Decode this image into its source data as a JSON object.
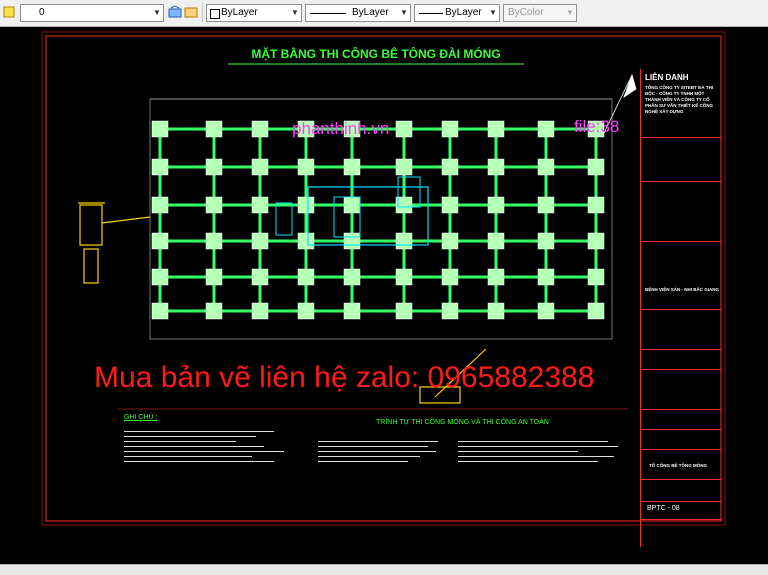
{
  "toolbar": {
    "layer_value": "0",
    "color_value": "ByLayer",
    "linetype_value": "ByLayer",
    "lineweight_value": "ByLayer",
    "plotstyle_value": "ByColor"
  },
  "drawing": {
    "title": "MẶT BẰNG THI CÔNG BÊ TÔNG ĐÀI MÓNG",
    "notes_heading": "GHI CHÚ :",
    "sequence_heading": "TRÌNH TỰ THI CÔNG MÓNG VÀ THI CÔNG AN TOÀN",
    "sheet_code": "BPTC - 08",
    "title_block": {
      "company": "LIÊN DANH",
      "company_detail": "TỔNG CÔNG TY SITEBT ĐÀ THI BỘC - CÔNG TY TNHH MỘT THÀNH VIÊN VÀ CÔNG TY CỔ PHẦN SƯ VẤN THIẾT KẾ CÔNG NGHỆ XÂY DỰNG",
      "project": "BỆNH VIỆN SẢN - NHI BẮC GIANG",
      "sheet_name": "TỔ CÔNG BÊ TÔNG MÓNG"
    }
  },
  "overlays": {
    "site": "phanthinh.vn",
    "file": "file:38",
    "contact": "Mua bản vẽ liên hệ zalo: 0965882388"
  },
  "colors": {
    "frame": "#ff2a2a",
    "pile_caps": "#b6ffb6",
    "beams": "#33ff66",
    "cyan": "#00e5ff",
    "yellow": "#ffd000",
    "title_green": "#39ff39",
    "watermark_red": "#ff1a1a",
    "watermark_magenta": "#ff3dff"
  }
}
